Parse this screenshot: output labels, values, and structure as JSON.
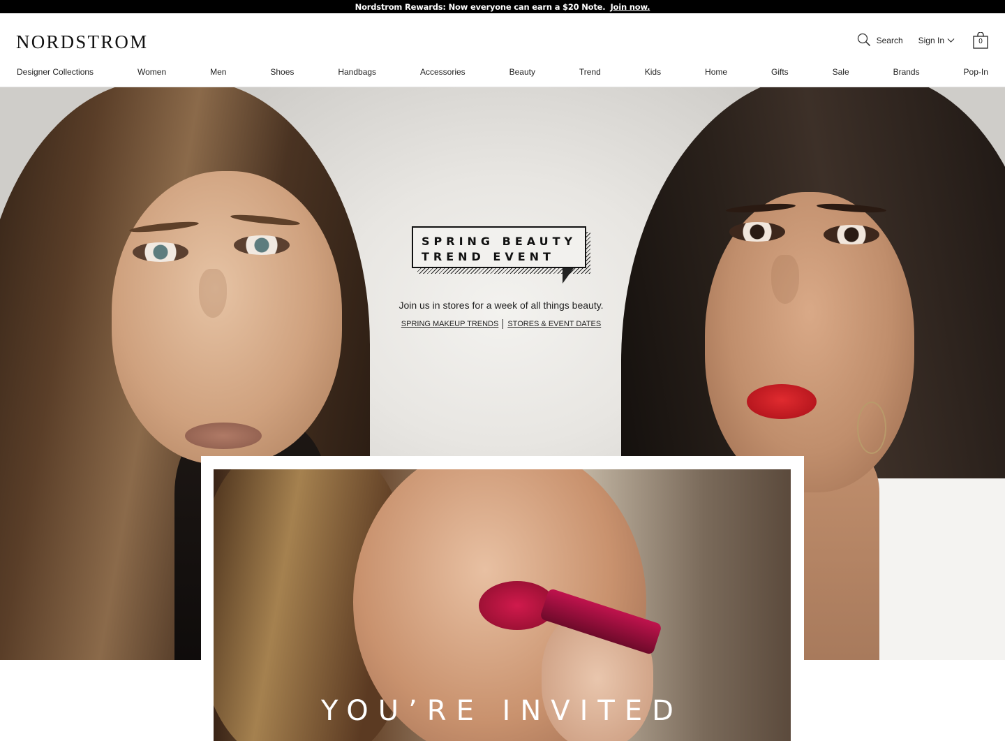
{
  "promo": {
    "text": "Nordstrom Rewards: Now everyone can earn a $20 Note.",
    "link": "Join now."
  },
  "header": {
    "logo": "NORDSTROM",
    "search_label": "Search",
    "signin_label": "Sign In",
    "bag_count": "0",
    "icons": [
      "search-icon",
      "chevron-down-icon",
      "shopping-bag-icon"
    ]
  },
  "nav": [
    "Designer Collections",
    "Women",
    "Men",
    "Shoes",
    "Handbags",
    "Accessories",
    "Beauty",
    "Trend",
    "Kids",
    "Home",
    "Gifts",
    "Sale",
    "Brands",
    "Pop-In"
  ],
  "hero": {
    "title_line1": "SPRING BEAUTY",
    "title_line2": "TREND EVENT",
    "subtitle": "Join us in stores for a week of all things beauty.",
    "link1": "SPRING MAKEUP TRENDS",
    "link2": "STORES & EVENT DATES"
  },
  "invite": {
    "title": "YOU’RE INVITED"
  }
}
